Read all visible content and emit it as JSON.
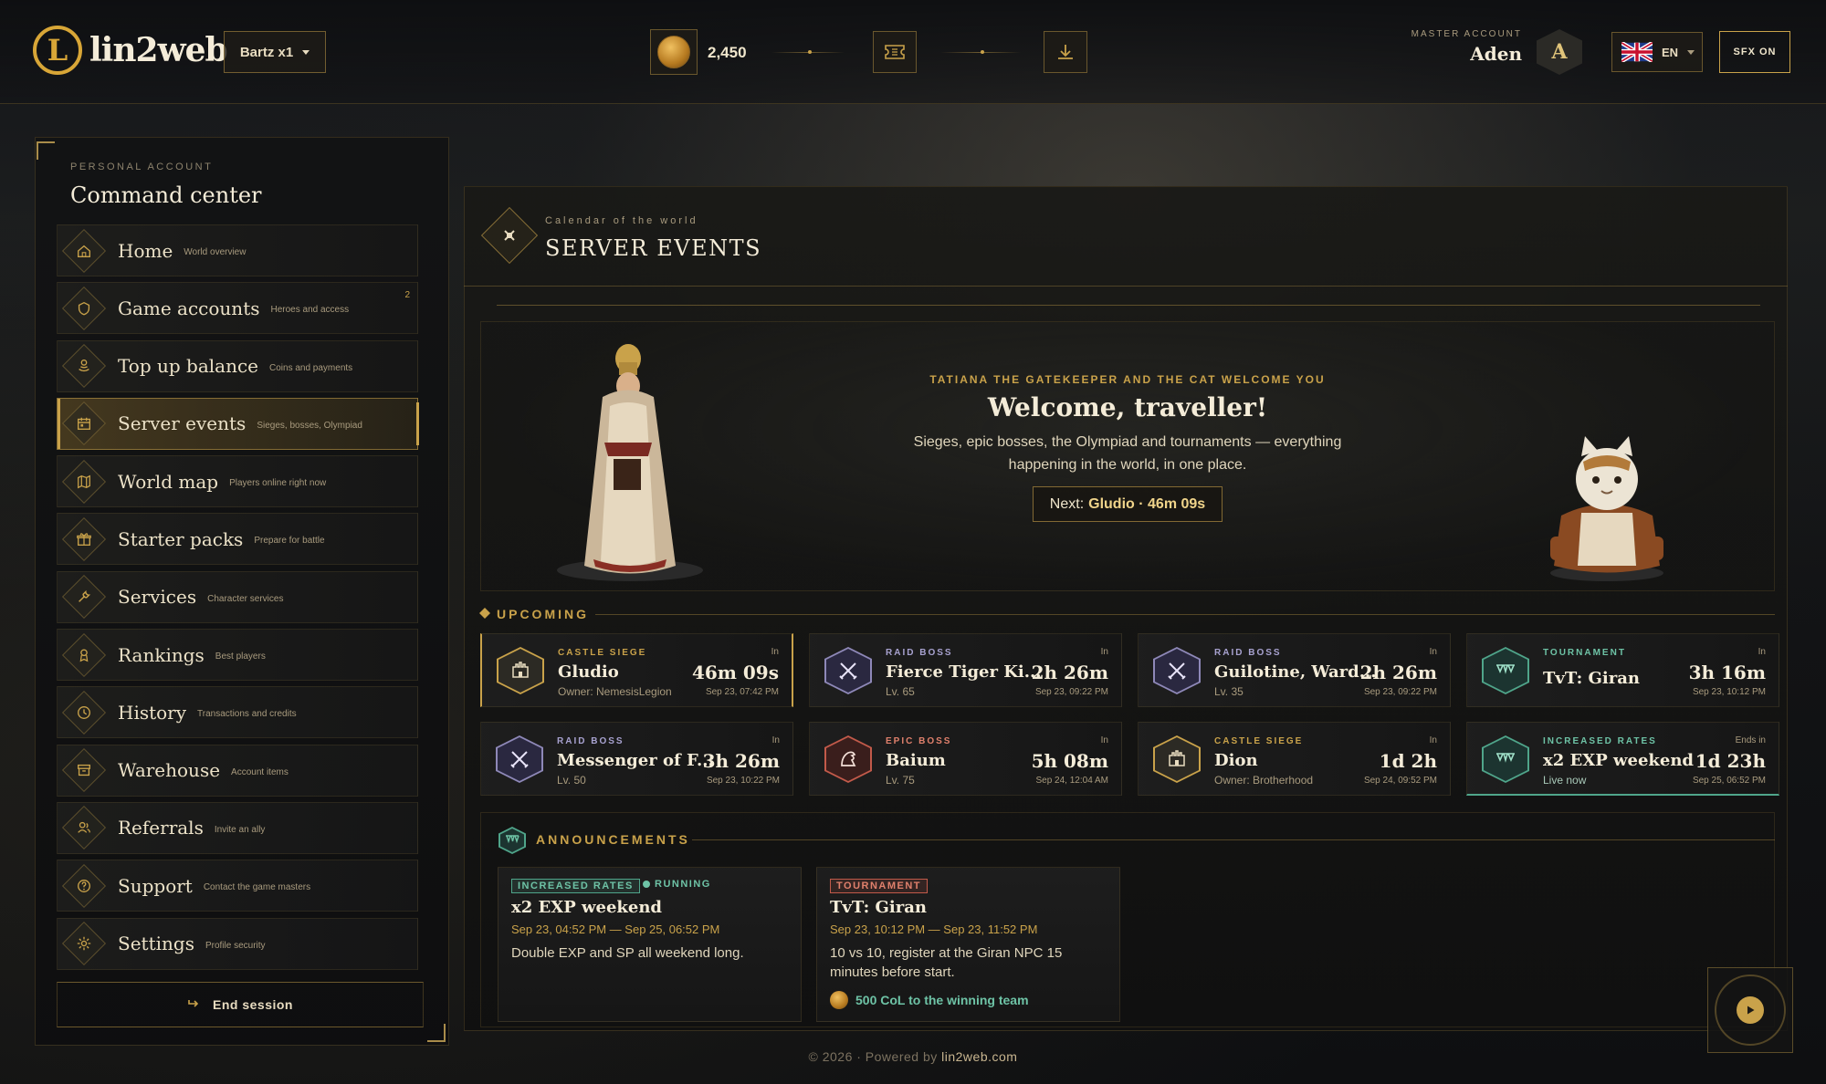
{
  "header": {
    "logo_text": "lin2web",
    "logo_letter": "L",
    "server": "Bartz x1",
    "balance": "2,450",
    "master_label": "MASTER ACCOUNT",
    "master_name": "Aden",
    "avatar_letter": "A",
    "language": "EN",
    "sfx": "SFX ON"
  },
  "sidebar": {
    "kicker": "PERSONAL ACCOUNT",
    "title": "Command center",
    "items": [
      {
        "label": "Home",
        "sub": "World overview",
        "icon": "home-icon"
      },
      {
        "label": "Game accounts",
        "sub": "Heroes and access",
        "icon": "shield-icon",
        "badge": "2"
      },
      {
        "label": "Top up balance",
        "sub": "Coins and payments",
        "icon": "coins-icon"
      },
      {
        "label": "Server events",
        "sub": "Sieges, bosses, Olympiad",
        "icon": "calendar-icon"
      },
      {
        "label": "World map",
        "sub": "Players online right now",
        "icon": "map-icon"
      },
      {
        "label": "Starter packs",
        "sub": "Prepare for battle",
        "icon": "gift-icon"
      },
      {
        "label": "Services",
        "sub": "Character services",
        "icon": "wrench-icon"
      },
      {
        "label": "Rankings",
        "sub": "Best players",
        "icon": "medal-icon"
      },
      {
        "label": "History",
        "sub": "Transactions and credits",
        "icon": "clock-icon"
      },
      {
        "label": "Warehouse",
        "sub": "Account items",
        "icon": "archive-icon"
      },
      {
        "label": "Referrals",
        "sub": "Invite an ally",
        "icon": "users-icon"
      },
      {
        "label": "Support",
        "sub": "Contact the game masters",
        "icon": "help-icon"
      },
      {
        "label": "Settings",
        "sub": "Profile security",
        "icon": "gear-icon"
      }
    ],
    "end_session": "End session"
  },
  "main": {
    "kicker": "Calendar of the world",
    "title": "SERVER EVENTS",
    "welcome": {
      "kicker": "TATIANA THE GATEKEEPER AND THE CAT WELCOME YOU",
      "title": "Welcome, traveller!",
      "text": "Sieges, epic bosses, the Olympiad and tournaments — everything happening in the world, in one place.",
      "next_label": "Next:",
      "next_value": "Gludio · 46m 09s"
    },
    "upcoming_label": "UPCOMING",
    "events": [
      {
        "type": "CASTLE SIEGE",
        "kind": "siege",
        "name": "Gludio",
        "sub": "Owner: NemesisLegion",
        "in": "In",
        "time": "46m 09s",
        "date": "Sep 23, 07:42 PM"
      },
      {
        "type": "RAID BOSS",
        "kind": "raid",
        "name": "Fierce Tiger Ki...",
        "sub": "Lv. 65",
        "in": "In",
        "time": "2h 26m",
        "date": "Sep 23, 09:22 PM"
      },
      {
        "type": "RAID BOSS",
        "kind": "raid",
        "name": "Guilotine, Ward...",
        "sub": "Lv. 35",
        "in": "In",
        "time": "2h 26m",
        "date": "Sep 23, 09:22 PM"
      },
      {
        "type": "TOURNAMENT",
        "kind": "tour",
        "name": "TvT: Giran",
        "sub": "",
        "in": "In",
        "time": "3h 16m",
        "date": "Sep 23, 10:12 PM"
      },
      {
        "type": "RAID BOSS",
        "kind": "raid",
        "name": "Messenger of F...",
        "sub": "Lv. 50",
        "in": "In",
        "time": "3h 26m",
        "date": "Sep 23, 10:22 PM"
      },
      {
        "type": "EPIC BOSS",
        "kind": "epic",
        "name": "Baium",
        "sub": "Lv. 75",
        "in": "In",
        "time": "5h 08m",
        "date": "Sep 24, 12:04 AM"
      },
      {
        "type": "CASTLE SIEGE",
        "kind": "siege",
        "name": "Dion",
        "sub": "Owner: Brotherhood",
        "in": "In",
        "time": "1d 2h",
        "date": "Sep 24, 09:52 PM"
      },
      {
        "type": "INCREASED RATES",
        "kind": "tour",
        "name": "x2 EXP weekend",
        "sub": "Live now",
        "in": "Ends in",
        "time": "1d 23h",
        "date": "Sep 25, 06:52 PM"
      }
    ],
    "announcements_label": "ANNOUNCEMENTS",
    "announcements": [
      {
        "tag": "INCREASED RATES",
        "status": "RUNNING",
        "title": "x2 EXP weekend",
        "date": "Sep 23, 04:52 PM — Sep 25, 06:52 PM",
        "text": "Double EXP and SP all weekend long.",
        "reward": ""
      },
      {
        "tag": "TOURNAMENT",
        "status": "",
        "title": "TvT: Giran",
        "date": "Sep 23, 10:12 PM — Sep 23, 11:52 PM",
        "text": "10 vs 10, register at the Giran NPC 15 minutes before start.",
        "reward": "500 CoL to the winning team"
      }
    ]
  },
  "footer": {
    "prefix": "© 2026 · Powered by",
    "link": "lin2web.com"
  },
  "colors": {
    "gold": "#c9a24a",
    "teal": "#4fa58a",
    "raid": "#8e88b8",
    "epic": "#c25a4a"
  }
}
